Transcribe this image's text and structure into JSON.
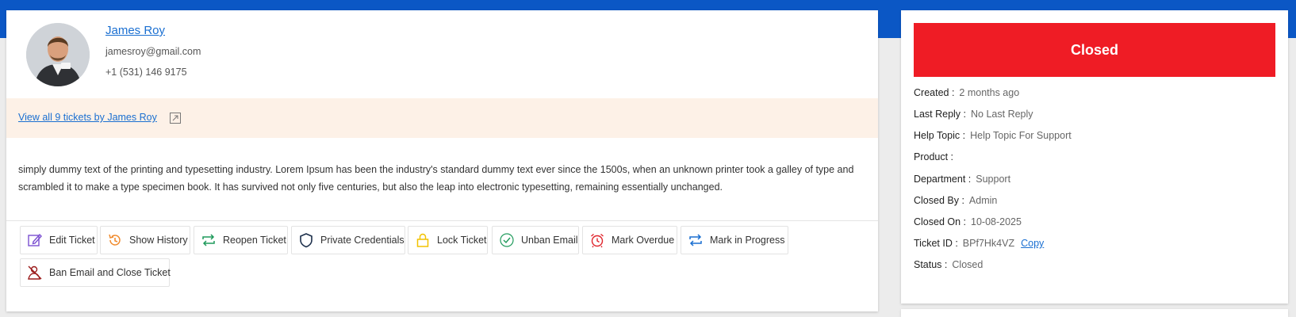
{
  "user": {
    "name": "James Roy",
    "email": "jamesroy@gmail.com",
    "phone": "+1 (531) 146 9175",
    "avatar_icon": "user-avatar"
  },
  "tickets_link": {
    "label": "View all 9 tickets by James Roy",
    "icon": "external-link-icon"
  },
  "description": "simply dummy text of the printing and typesetting industry. Lorem Ipsum has been the industry's standard dummy text ever since the 1500s, when an unknown printer took a galley of type and scrambled it to make a type specimen book. It has survived not only five centuries, but also the leap into electronic typesetting, remaining essentially unchanged.",
  "actions": [
    {
      "label": "Edit Ticket",
      "icon": "edit-icon",
      "color": "#7b4fd1"
    },
    {
      "label": "Show History",
      "icon": "history-icon",
      "color": "#f08a2c"
    },
    {
      "label": "Reopen Ticket",
      "icon": "reopen-icon",
      "color": "#1f9a5b"
    },
    {
      "label": "Private Credentials",
      "icon": "shield-icon",
      "color": "#1b2e4a"
    },
    {
      "label": "Lock Ticket",
      "icon": "lock-icon",
      "color": "#f2c200"
    },
    {
      "label": "Unban Email",
      "icon": "check-circle-icon",
      "color": "#1f9a5b"
    },
    {
      "label": "Mark Overdue",
      "icon": "alarm-icon",
      "color": "#e0242c"
    },
    {
      "label": "Mark in Progress",
      "icon": "progress-icon",
      "color": "#1a6fd1"
    },
    {
      "label": "Ban Email and Close Ticket",
      "icon": "ban-user-icon",
      "color": "#9b1b1b"
    }
  ],
  "status_banner": {
    "label": "Closed",
    "color": "#ef1c25"
  },
  "details": [
    {
      "label": "Created :",
      "value": "2 months ago"
    },
    {
      "label": "Last Reply :",
      "value": "No Last Reply"
    },
    {
      "label": "Help Topic :",
      "value": "Help Topic For Support"
    },
    {
      "label": "Product :",
      "value": ""
    },
    {
      "label": "Department :",
      "value": "Support"
    },
    {
      "label": "Closed By :",
      "value": "Admin"
    },
    {
      "label": "Closed On :",
      "value": "10-08-2025"
    },
    {
      "label": "Ticket ID :",
      "value": "BPf7Hk4VZ",
      "action": "Copy"
    },
    {
      "label": "Status :",
      "value": "Closed"
    }
  ]
}
